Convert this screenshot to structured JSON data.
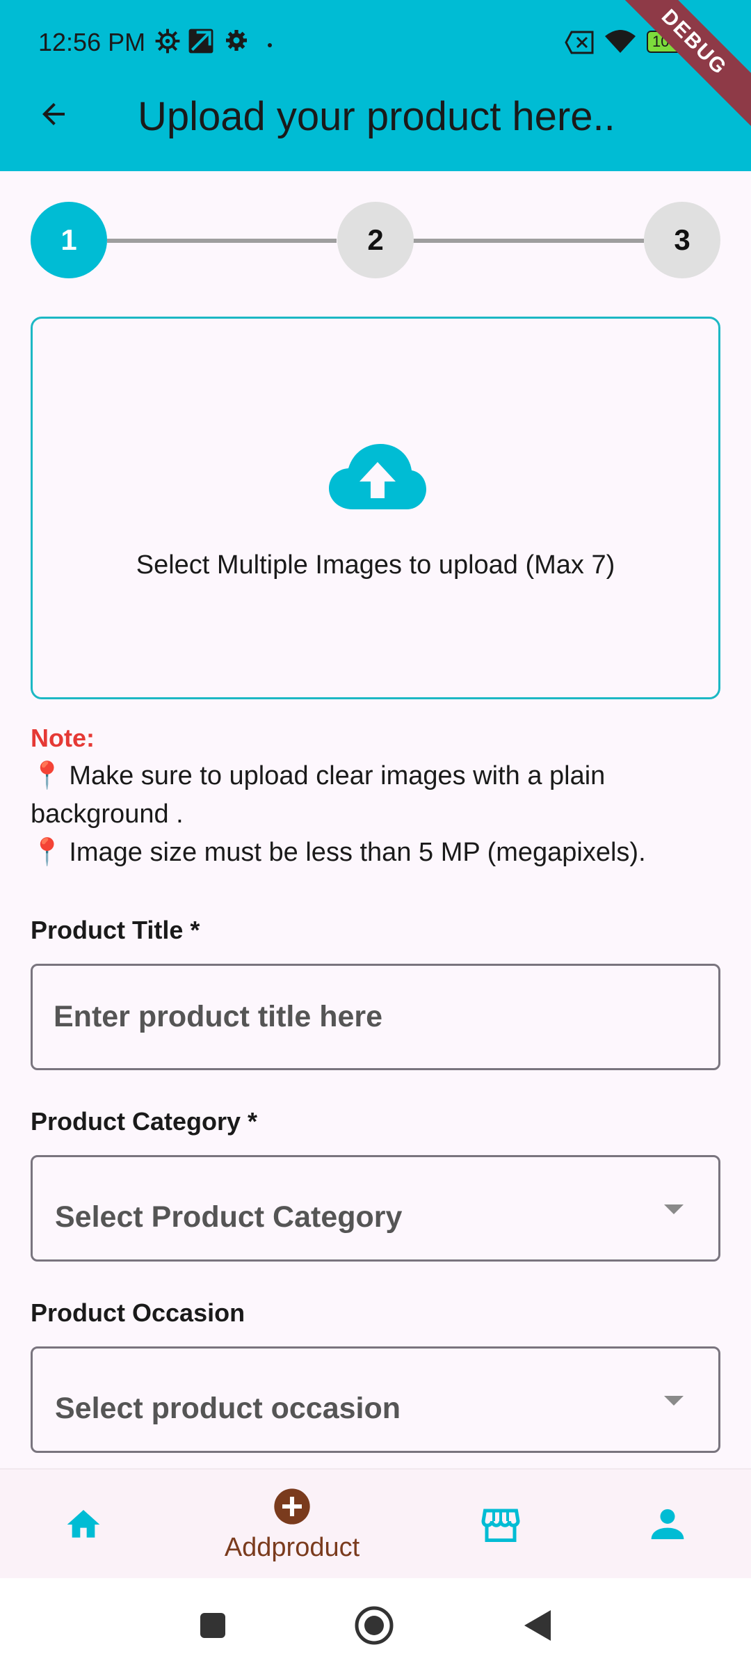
{
  "status_bar": {
    "time": "12:56 PM",
    "battery": "100",
    "icons": [
      "settings-gear-icon",
      "navigation-app-icon",
      "settings-icon",
      "dot-icon",
      "no-sim-icon",
      "wifi-icon",
      "battery-icon"
    ]
  },
  "debug_banner": "DEBUG",
  "app_bar": {
    "title": "Upload your product here..",
    "back_icon": "arrow-back-icon"
  },
  "stepper": {
    "steps": [
      "1",
      "2",
      "3"
    ],
    "active_step": 1
  },
  "upload": {
    "icon": "cloud-upload-icon",
    "text": "Select Multiple Images to upload (Max 7)"
  },
  "note": {
    "title": "Note:",
    "lines": [
      "Make sure to upload clear images with a plain background .",
      "Image size must be less than 5 MP (megapixels)."
    ],
    "bullet_icon": "pin-icon"
  },
  "form": {
    "title": {
      "label": "Product Title *",
      "placeholder": "Enter product title here"
    },
    "category": {
      "label": "Product Category *",
      "placeholder": "Select Product Category"
    },
    "occasion": {
      "label": "Product Occasion",
      "placeholder": "Select product occasion"
    }
  },
  "bottom_nav": {
    "items": [
      {
        "icon": "home-icon",
        "label": ""
      },
      {
        "icon": "add-circle-icon",
        "label": "Addproduct"
      },
      {
        "icon": "store-icon",
        "label": ""
      },
      {
        "icon": "person-icon",
        "label": ""
      }
    ],
    "active_index": 1,
    "colors": {
      "active": "#7a3b1d",
      "inactive": "#00bcd4"
    }
  },
  "system_nav": [
    "recents-icon",
    "home-circle-icon",
    "back-triangle-icon"
  ],
  "colors": {
    "primary": "#00bcd4",
    "note": "#e53935",
    "background": "#fdf7fd"
  }
}
